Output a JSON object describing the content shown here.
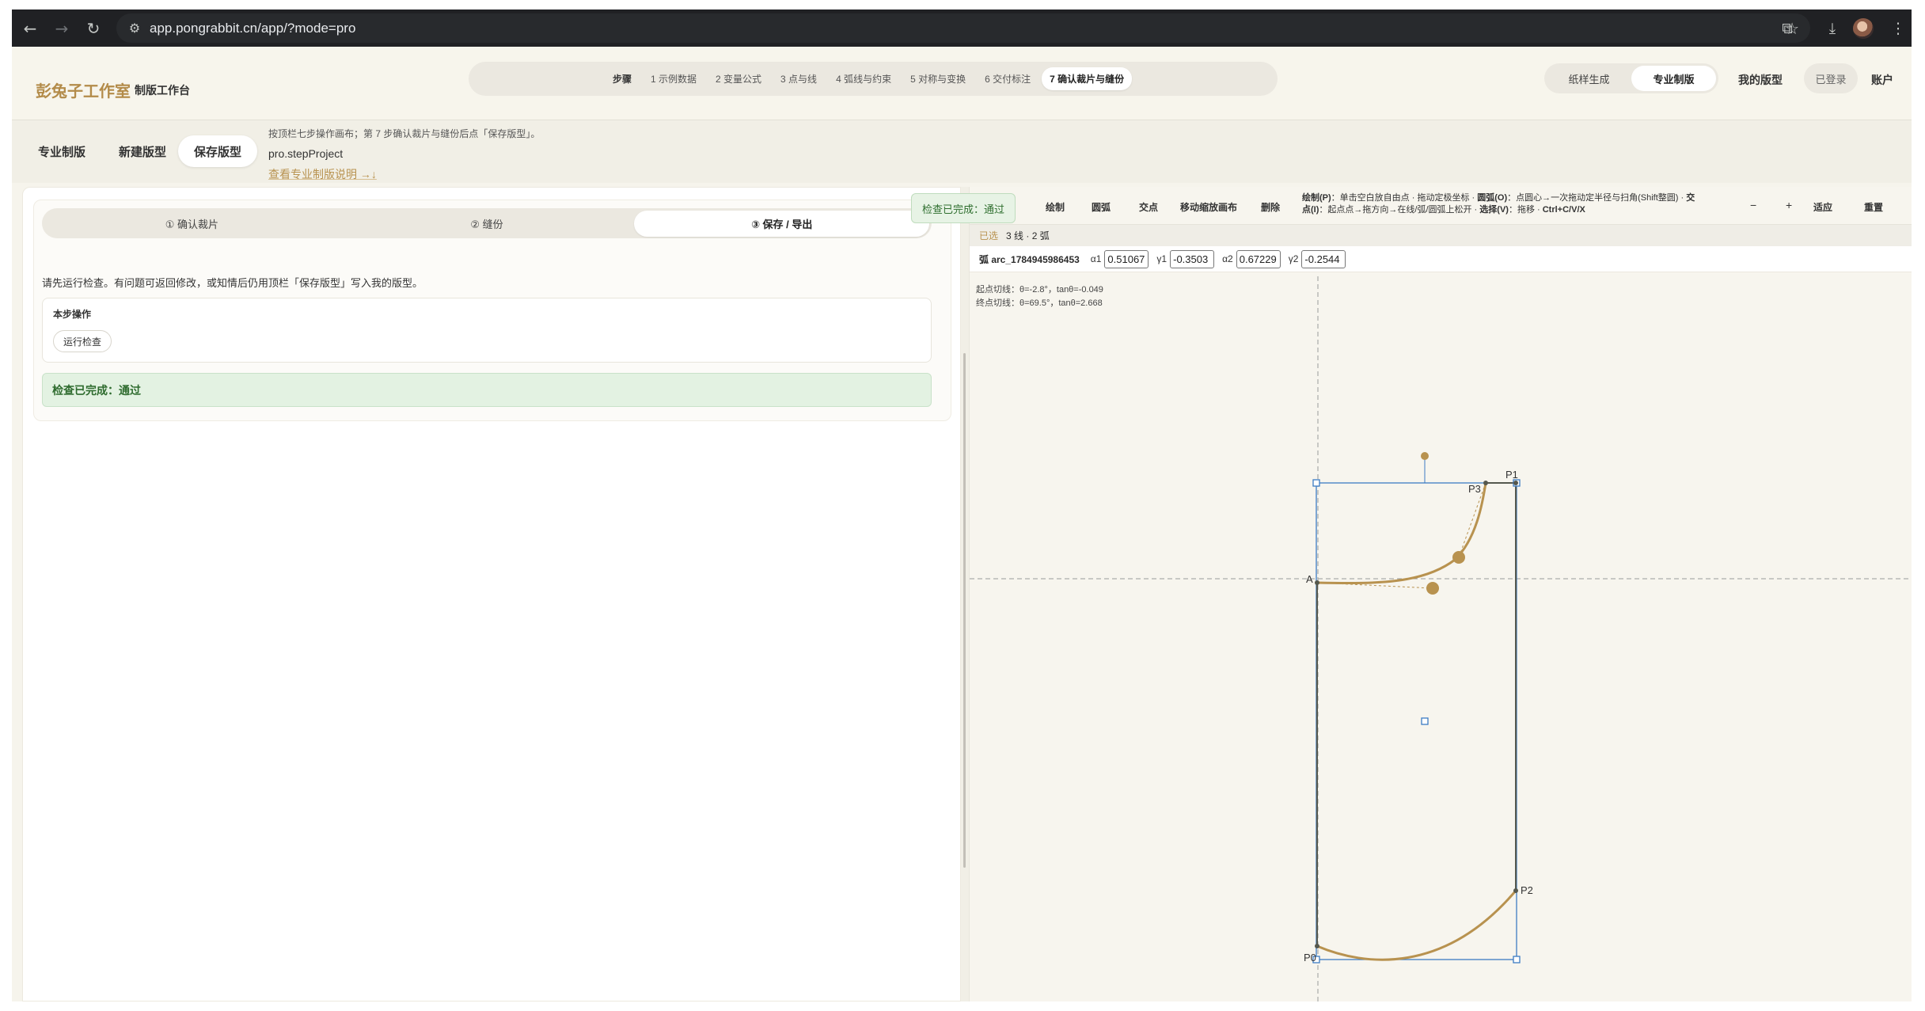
{
  "browser": {
    "url": "app.pongrabbit.cn/app/?mode=pro",
    "back_icon": "arrow-left-icon",
    "forward_icon": "arrow-right-icon",
    "reload_icon": "reload-icon"
  },
  "header": {
    "brand": "彭兔子工作室",
    "subtitle": "制版工作台",
    "steps": [
      {
        "label": "步骤"
      },
      {
        "label": "1 示例数据"
      },
      {
        "label": "2 变量公式"
      },
      {
        "label": "3 点与线"
      },
      {
        "label": "4 弧线与约束"
      },
      {
        "label": "5 对称与变换"
      },
      {
        "label": "6 交付标注"
      },
      {
        "label": "7 确认裁片与缝份"
      }
    ],
    "active_step_index": 7,
    "modes": [
      "纸样生成",
      "专业制版"
    ],
    "active_mode": "专业制版",
    "my_patterns": "我的版型",
    "login_status": "已登录",
    "account": "账户"
  },
  "subbar": {
    "tabs": [
      "专业制版",
      "新建版型",
      "保存版型"
    ],
    "active_tab": "保存版型",
    "hint": "按顶栏七步操作画布；第 7 步确认裁片与缝份后点「保存版型」。",
    "project": "pro.stepProject",
    "doc_link": "查看专业制版说明 →↓"
  },
  "left": {
    "tabs": [
      "① 确认裁片",
      "② 缝份",
      "③ 保存 / 导出"
    ],
    "active_tab": "③ 保存 / 导出",
    "description": "请先运行检查。有问题可返回修改，或知情后仍用顶栏「保存版型」写入我的版型。",
    "op_title": "本步操作",
    "run_check": "运行检查",
    "result": "检查已完成：通过"
  },
  "canvas": {
    "toast": "检查已完成：通过",
    "tools": [
      "绘制",
      "圆弧",
      "交点",
      "移动缩放画布",
      "删除"
    ],
    "help_line1_a": "绘制(P)",
    "help_line1_b": "：单击空白放自由点 · 拖动定极坐标 · ",
    "help_line1_c": "圆弧(O)",
    "help_line1_d": "：点圆心→一次拖动定半径与扫角(Shift整圆) · ",
    "help_line1_e": "交",
    "help_line2_a": "点(I)",
    "help_line2_b": "：起点点→拖方向→在线/弧/圆弧上松开 · ",
    "help_line2_c": "选择(V)",
    "help_line2_d": "：拖移 · ",
    "help_line2_e": "Ctrl+C/V/X",
    "zoom_out": "−",
    "zoom_in": "+",
    "fit": "适应",
    "reset": "重置",
    "selected_tag": "已选",
    "selected_info": "3 线 · 2 弧",
    "arc_name": "弧 arc_1784945986453",
    "alpha1_label": "α1",
    "alpha1": "0.51067",
    "gamma1_label": "γ1",
    "gamma1": "-0.3503",
    "alpha2_label": "α2",
    "alpha2": "0.67229",
    "gamma2_label": "γ2",
    "gamma2": "-0.2544",
    "tangent_start": "起点切线：θ=-2.8°，tanθ=-0.049",
    "tangent_end": "终点切线：θ=69.5°，tanθ=2.668",
    "point_labels": {
      "p1": "P1",
      "p2": "P2",
      "p3": "P3",
      "a": "A",
      "p0": "P0"
    },
    "colors": {
      "curve": "#b8924f",
      "line": "#6b6e62",
      "selection": "#3c7cc4",
      "guide": "#a9a9a9"
    }
  }
}
